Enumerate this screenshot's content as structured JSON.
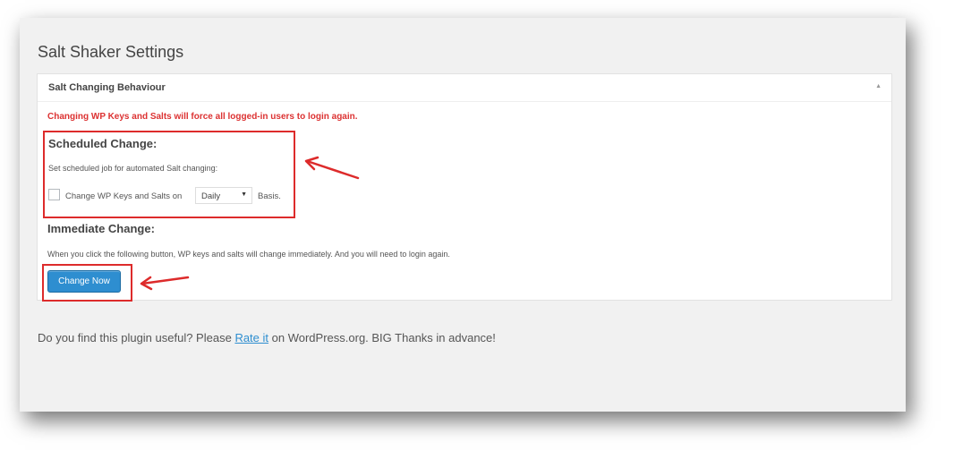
{
  "page": {
    "title": "Salt Shaker Settings"
  },
  "panel": {
    "title": "Salt Changing Behaviour",
    "warning": "Changing WP Keys and Salts will force all logged-in users to login again."
  },
  "scheduled": {
    "heading": "Scheduled Change:",
    "description": "Set scheduled job for automated Salt changing:",
    "checkbox_label": "Change WP Keys and Salts on",
    "interval_value": "Daily",
    "suffix": "Basis."
  },
  "immediate": {
    "heading": "Immediate Change:",
    "description": "When you click the following button, WP keys and salts will change immediately. And you will need to login again.",
    "button_label": "Change Now"
  },
  "footer": {
    "prefix": "Do you find this plugin useful? Please",
    "link_text": "Rate it",
    "suffix": "on WordPress.org. BIG Thanks in advance!"
  },
  "colors": {
    "warning": "#dc3232",
    "button": "#2e8ed0",
    "annotation": "#dd2b2b"
  }
}
